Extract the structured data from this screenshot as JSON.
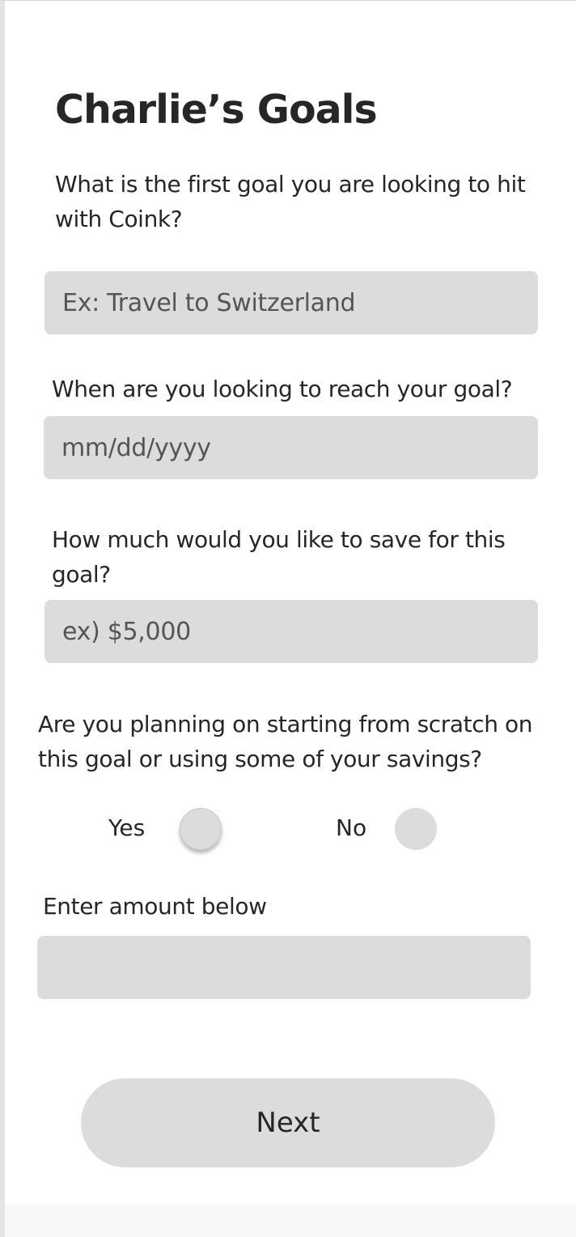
{
  "page": {
    "title": "Charlie’s Goals"
  },
  "goal": {
    "question": "What is the first goal you are looking to hit with Coink?",
    "placeholder": "Ex: Travel to Switzerland"
  },
  "date": {
    "question": "When are you looking to reach your goal?",
    "placeholder": "mm/dd/yyyy"
  },
  "amount": {
    "question": "How much would you like to save for this goal?",
    "placeholder": "ex) $5,000"
  },
  "start": {
    "question": "Are you planning on starting from scratch on this goal or using some of your savings?",
    "yes_label": "Yes",
    "no_label": "No"
  },
  "savings": {
    "label": "Enter amount below",
    "value": ""
  },
  "actions": {
    "next_label": "Next"
  }
}
